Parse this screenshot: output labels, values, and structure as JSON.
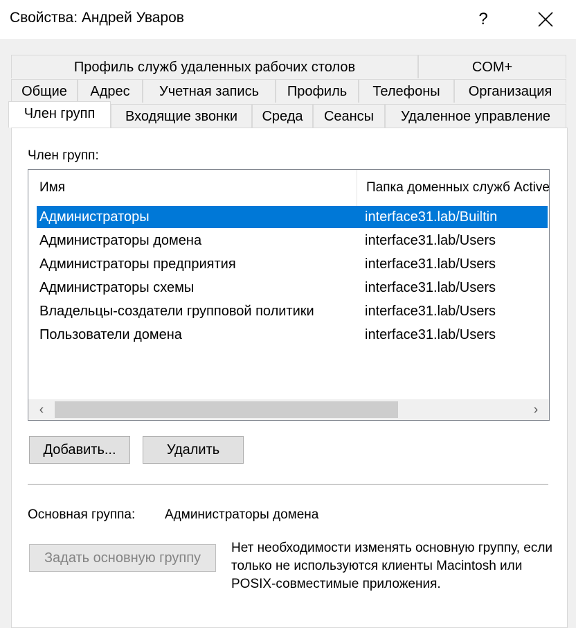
{
  "window": {
    "title": "Свойства: Андрей Уваров",
    "help_label": "?"
  },
  "tabs": {
    "row1": [
      {
        "label": "Профиль служб удаленных рабочих столов"
      },
      {
        "label": "COM+"
      }
    ],
    "row2": [
      {
        "label": "Общие"
      },
      {
        "label": "Адрес"
      },
      {
        "label": "Учетная запись"
      },
      {
        "label": "Профиль"
      },
      {
        "label": "Телефоны"
      },
      {
        "label": "Организация"
      }
    ],
    "row3": [
      {
        "label": "Член групп",
        "active": true
      },
      {
        "label": "Входящие звонки"
      },
      {
        "label": "Среда"
      },
      {
        "label": "Сеансы"
      },
      {
        "label": "Удаленное управление"
      }
    ]
  },
  "members": {
    "label": "Член групп:",
    "columns": [
      "Имя",
      "Папка доменных служб Active Directory"
    ],
    "rows": [
      {
        "name": "Администраторы",
        "folder": "interface31.lab/Builtin",
        "selected": true
      },
      {
        "name": "Администраторы домена",
        "folder": "interface31.lab/Users"
      },
      {
        "name": "Администраторы предприятия",
        "folder": "interface31.lab/Users"
      },
      {
        "name": "Администраторы схемы",
        "folder": "interface31.lab/Users"
      },
      {
        "name": "Владельцы-создатели групповой политики",
        "folder": "interface31.lab/Users"
      },
      {
        "name": "Пользователи домена",
        "folder": "interface31.lab/Users"
      }
    ],
    "scroll_left": "‹",
    "scroll_right": "›"
  },
  "buttons": {
    "add": "Добавить...",
    "remove": "Удалить",
    "set_primary": "Задать основную группу"
  },
  "primary_group": {
    "label": "Основная группа:",
    "value": "Администраторы домена"
  },
  "note": "Нет необходимости изменять основную группу, если только не используются клиенты Macintosh или POSIX-совместимые приложения.",
  "colors": {
    "selection": "#0078d7",
    "panel": "#ffffff",
    "window": "#f0f0f0"
  }
}
